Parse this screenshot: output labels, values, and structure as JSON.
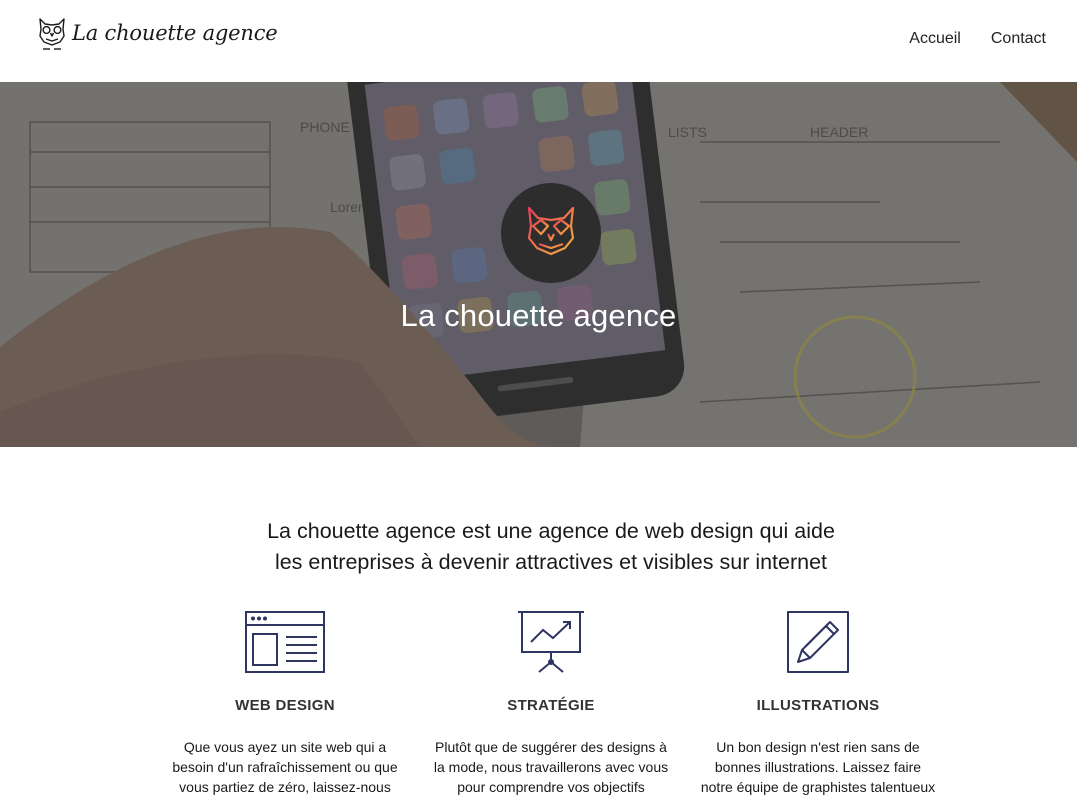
{
  "header": {
    "brand_name": "La chouette agence",
    "logo_icon": "owl-icon",
    "nav": [
      {
        "label": "Accueil"
      },
      {
        "label": "Contact"
      }
    ]
  },
  "hero": {
    "logo_icon": "owl-icon",
    "title": "La chouette agence",
    "sketch_texts": [
      "PHONE",
      "LISTS",
      "HEADER",
      "Lorem"
    ]
  },
  "intro": {
    "line1": "La chouette agence est une agence de web design qui aide",
    "line2": "les entreprises à devenir attractives et visibles sur internet"
  },
  "services": [
    {
      "icon": "web-design-icon",
      "title": "WEB DESIGN",
      "lines": [
        "Que vous ayez un site web qui a",
        "besoin d'un rafraîchissement ou que",
        "vous partiez de zéro, laissez-nous"
      ]
    },
    {
      "icon": "presentation-chart-icon",
      "title": "STRATÉGIE",
      "lines": [
        "Plutôt que de suggérer des designs à",
        "la mode, nous travaillerons avec vous",
        "pour comprendre vos objectifs"
      ]
    },
    {
      "icon": "pencil-icon",
      "title": "ILLUSTRATIONS",
      "lines": [
        "Un bon design n'est rien sans de",
        "bonnes illustrations. Laissez faire",
        "notre équipe de graphistes talentueux"
      ]
    }
  ],
  "colors": {
    "icon_stroke": "#2e3561",
    "hero_overlay": "#5b5956",
    "logo_gradient_start": "#e8405a",
    "logo_gradient_end": "#f4b03c"
  }
}
